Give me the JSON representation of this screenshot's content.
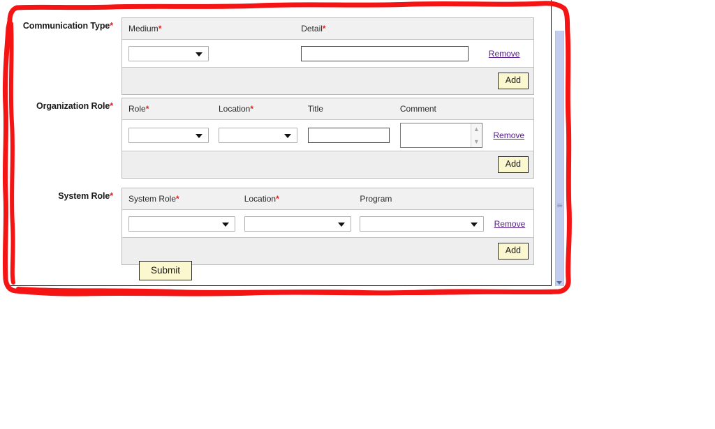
{
  "page": {
    "required_marker": "*",
    "remove_label": "Remove",
    "add_label": "Add",
    "submit_label": "Submit"
  },
  "sections": [
    {
      "id": "communication-type",
      "label": "Communication Type",
      "required": true,
      "columns": [
        {
          "header": "Medium",
          "required": true,
          "control": "select"
        },
        {
          "header": "Detail",
          "required": true,
          "control": "text"
        }
      ],
      "rows": [
        {
          "medium": "",
          "detail": ""
        }
      ]
    },
    {
      "id": "organization-role",
      "label": "Organization Role",
      "required": true,
      "columns": [
        {
          "header": "Role",
          "required": true,
          "control": "select"
        },
        {
          "header": "Location",
          "required": true,
          "control": "select"
        },
        {
          "header": "Title",
          "required": false,
          "control": "text"
        },
        {
          "header": "Comment",
          "required": false,
          "control": "textarea"
        }
      ],
      "rows": [
        {
          "role": "",
          "location": "",
          "title": "",
          "comment": ""
        }
      ]
    },
    {
      "id": "system-role",
      "label": "System Role",
      "required": true,
      "columns": [
        {
          "header": "System Role",
          "required": true,
          "control": "select"
        },
        {
          "header": "Location",
          "required": true,
          "control": "select"
        },
        {
          "header": "Program",
          "required": false,
          "control": "select"
        }
      ],
      "rows": [
        {
          "system_role": "",
          "location": "",
          "program": ""
        }
      ]
    }
  ],
  "colors": {
    "required_asterisk": "#e02020",
    "header_background": "#f1f1f1",
    "footer_background": "#eeeeee",
    "button_yellow": "#fbf7cf",
    "link_purple": "#551a8b",
    "annotation_red": "#f41414",
    "scrollbar_track": "#c3cdf0"
  },
  "scrollbar": {
    "orientation": "vertical",
    "position": "right"
  },
  "annotation": {
    "shape": "freehand-rectangle",
    "color": "#f41414"
  }
}
